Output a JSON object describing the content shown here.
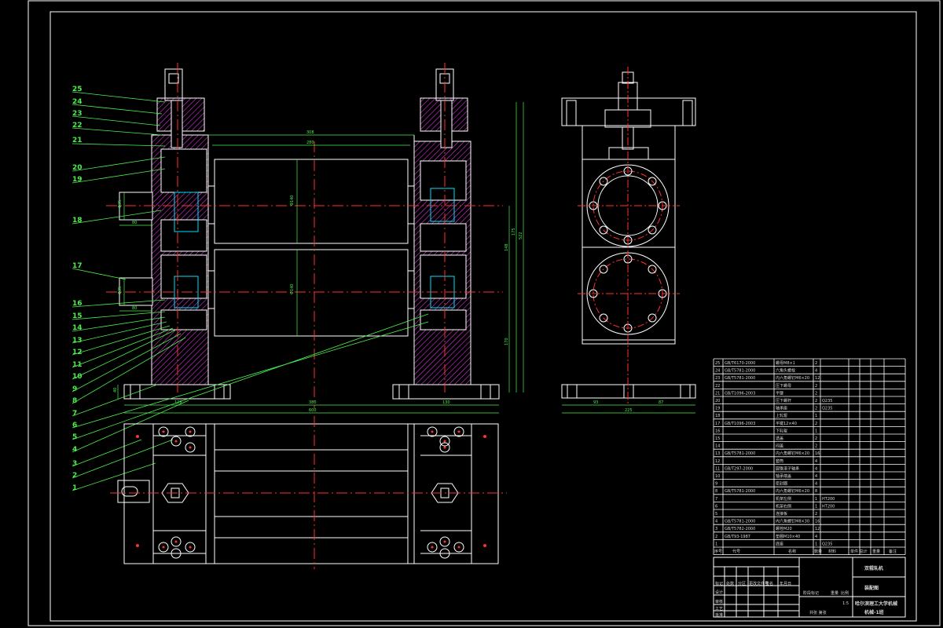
{
  "drawing": {
    "part_numbers": [
      "25",
      "24",
      "23",
      "22",
      "21",
      "20",
      "19",
      "18",
      "17",
      "16",
      "15",
      "14",
      "13",
      "12",
      "11",
      "10",
      "9",
      "8",
      "7",
      "6",
      "5",
      "4",
      "3",
      "2",
      "1"
    ],
    "dimensions": {
      "top_outer": "308",
      "top_inner": "280",
      "roll_dia_upper": "Φ140",
      "roll_dia_lower": "Φ140",
      "left_shaft_upper": "Φ35",
      "left_shaft_lower": "Φ35",
      "shaft_len_upper": "80",
      "shaft_len_lower": "80",
      "height_total": "522",
      "height_mid": "148",
      "height_right": "175",
      "height_low": "170",
      "height_base": "40",
      "bottom_left": "128",
      "bottom_mid": "380",
      "bottom_right": "130",
      "bottom_total": "600",
      "side_left": "93",
      "side_right": "87",
      "side_total": "225"
    },
    "parts_table": {
      "rows": [
        {
          "no": "25",
          "code": "GB/T6170-2000",
          "name": "螺母M8×1",
          "qty": "2",
          "material": ""
        },
        {
          "no": "24",
          "code": "GB/T5781-2000",
          "name": "六角头螺栓",
          "qty": "4",
          "material": ""
        },
        {
          "no": "23",
          "code": "GB/T5781-2000",
          "name": "内六角螺钉M6×20",
          "qty": "12",
          "material": ""
        },
        {
          "no": "22",
          "code": "",
          "name": "压下螺母",
          "qty": "2",
          "material": ""
        },
        {
          "no": "21",
          "code": "GB/T1096-2003",
          "name": "平键",
          "qty": "2",
          "material": ""
        },
        {
          "no": "20",
          "code": "",
          "name": "压下螺杆",
          "qty": "2",
          "material": "Q235"
        },
        {
          "no": "19",
          "code": "",
          "name": "轴承座",
          "qty": "2",
          "material": "Q235"
        },
        {
          "no": "18",
          "code": "",
          "name": "上轧辊",
          "qty": "1",
          "material": ""
        },
        {
          "no": "17",
          "code": "GB/T1096-2003",
          "name": "平键12×40",
          "qty": "2",
          "material": ""
        },
        {
          "no": "16",
          "code": "",
          "name": "下轧辊",
          "qty": "1",
          "material": ""
        },
        {
          "no": "15",
          "code": "",
          "name": "透盖",
          "qty": "2",
          "material": ""
        },
        {
          "no": "14",
          "code": "",
          "name": "闷盖",
          "qty": "2",
          "material": ""
        },
        {
          "no": "13",
          "code": "GB/T5781-2000",
          "name": "内六角螺钉M6×20",
          "qty": "16",
          "material": ""
        },
        {
          "no": "12",
          "code": "",
          "name": "套筒",
          "qty": "4",
          "material": ""
        },
        {
          "no": "11",
          "code": "GB/T297-2000",
          "name": "圆锥滚子轴承",
          "qty": "4",
          "material": ""
        },
        {
          "no": "10",
          "code": "",
          "name": "轴承端盖",
          "qty": "4",
          "material": ""
        },
        {
          "no": "9",
          "code": "",
          "name": "密封圈",
          "qty": "4",
          "material": ""
        },
        {
          "no": "8",
          "code": "GB/T5781-2000",
          "name": "内六角螺钉M6×20",
          "qty": "8",
          "material": ""
        },
        {
          "no": "7",
          "code": "",
          "name": "机架左侧",
          "qty": "1",
          "material": "HT200"
        },
        {
          "no": "6",
          "code": "",
          "name": "机架右侧",
          "qty": "1",
          "material": "HT200"
        },
        {
          "no": "5",
          "code": "",
          "name": "连接板",
          "qty": "2",
          "material": ""
        },
        {
          "no": "4",
          "code": "GB/T5781-2000",
          "name": "内六角螺钉M8×30",
          "qty": "16",
          "material": ""
        },
        {
          "no": "3",
          "code": "GB/T5782-2000",
          "name": "螺栓M20",
          "qty": "12",
          "material": ""
        },
        {
          "no": "2",
          "code": "GB/T93-1987",
          "name": "垫圈M10×40",
          "qty": "4",
          "material": ""
        },
        {
          "no": "1",
          "code": "",
          "name": "底座",
          "qty": "1",
          "material": "Q235"
        }
      ],
      "header": {
        "no": "序号",
        "code": "代号",
        "name": "名称",
        "qty": "数量",
        "material": "材料",
        "mass": "单件 总计",
        "weight": "重量",
        "note": "备注"
      }
    },
    "title_block": {
      "title_main": "双辊轧机",
      "drawing_name": "装配图",
      "school": "哈尔滨理工大学机械",
      "class": "机械-1班",
      "scale_label": "比例",
      "scale": "1:5",
      "sheet": "共张 第张",
      "labels": [
        "标记",
        "处数",
        "分区",
        "更改文件号",
        "签名",
        "年月日",
        "设计",
        "审核",
        "工艺",
        "批准",
        "阶段标记",
        "重量"
      ]
    }
  }
}
